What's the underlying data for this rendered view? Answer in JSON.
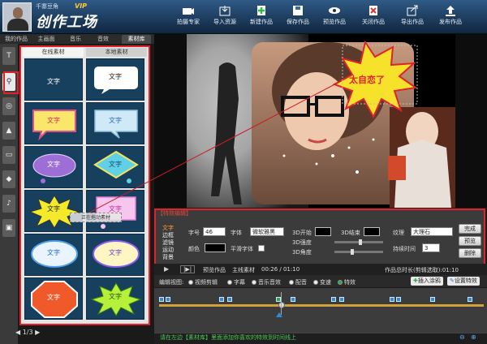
{
  "header": {
    "username": "千寨豆角",
    "app_title": "创作工场",
    "vip": "VIP"
  },
  "toolbar": [
    {
      "label": "拍摄专家",
      "icon": "camera-icon"
    },
    {
      "label": "导入资源",
      "icon": "import-icon"
    },
    {
      "label": "新建作品",
      "icon": "new-icon"
    },
    {
      "label": "保存作品",
      "icon": "save-icon"
    },
    {
      "label": "预览作品",
      "icon": "eye-icon"
    },
    {
      "label": "关闭作品",
      "icon": "close-icon"
    },
    {
      "label": "导出作品",
      "icon": "export-icon"
    },
    {
      "label": "发布作品",
      "icon": "publish-icon"
    }
  ],
  "tabs": [
    "我的作品",
    "主画面",
    "音乐",
    "音效",
    "素材库"
  ],
  "panel": {
    "subtabs": [
      "在线素材",
      "本地素材"
    ],
    "tiles": [
      "文字",
      "文字",
      "文字",
      "文字",
      "文字",
      "文字",
      "文字",
      "文字",
      "文字",
      "文字",
      "文字",
      "文字"
    ],
    "drag_hint": "正在拖动素材",
    "page": "1/3"
  },
  "stage": {
    "bubble_text": "太自恋了"
  },
  "effects": {
    "header": "【特效编辑】",
    "categories": [
      "文字",
      "边框",
      "滤镜",
      "运动",
      "背景"
    ],
    "font_size_label": "字号",
    "font_size": "46",
    "font_label": "字体",
    "font": "微软雅黑",
    "color_label": "颜色",
    "fill_label": "平滑字体",
    "start3d_label": "3D开始",
    "end3d_label": "3D结束",
    "texture_label": "纹理",
    "texture": "大理石",
    "strength_label": "3D强度",
    "angle_label": "3D角度",
    "duration_label": "持续时间",
    "duration": "3",
    "btn_done": "完成",
    "btn_preview": "预览",
    "btn_delete": "删除"
  },
  "playbar": {
    "play_icon": "play-icon",
    "btn1": "|▶|",
    "btn2": "预览作品",
    "btn3": "主线素材",
    "time": "00:26 / 01:10",
    "total": "作品总时长(剪辑选取):01:10"
  },
  "editbar": {
    "label": "编辑视图:",
    "modes": [
      "视频剪辑",
      "字幕",
      "音乐音效",
      "配音",
      "变速",
      "特效"
    ],
    "selected": "特效",
    "insert_btn": "插入涂鸦",
    "settings_btn": "设置特效"
  },
  "status": {
    "text": "请在左边【素材库】里面添加你喜欢的特效到时间线上"
  },
  "colors": {
    "accent_red": "#e0222a",
    "track": "#d2a23a",
    "status_green": "#4ecb5a"
  }
}
